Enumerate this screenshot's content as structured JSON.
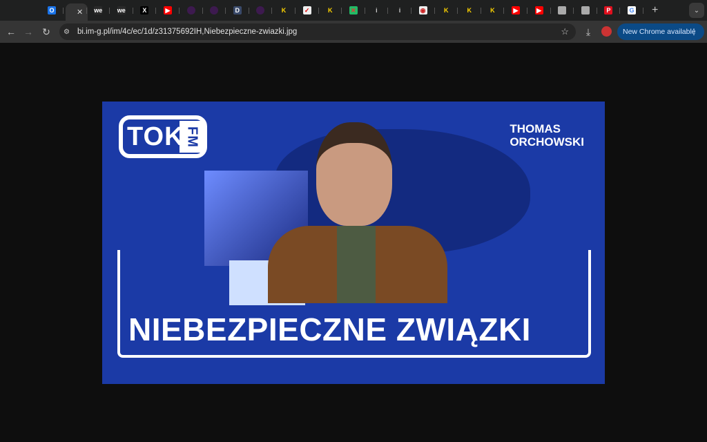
{
  "tabs": [
    {
      "icon": "outlook-icon",
      "color": "#1a73e8",
      "glyph": "O"
    },
    {
      "icon": "blank-icon",
      "color": "#353535",
      "glyph": "",
      "active": true
    },
    {
      "icon": "we-icon",
      "color": "#2a2a2a",
      "glyph": "we"
    },
    {
      "icon": "we-icon",
      "color": "#2a2a2a",
      "glyph": "we"
    },
    {
      "icon": "x-icon",
      "color": "#000",
      "glyph": "X"
    },
    {
      "icon": "youtube-icon",
      "color": "#ff0000",
      "glyph": "▶"
    },
    {
      "icon": "purple-circle-icon",
      "color": "#3d1a4f",
      "glyph": ""
    },
    {
      "icon": "purple-circle-icon",
      "color": "#3d1a4f",
      "glyph": ""
    },
    {
      "icon": "d-icon",
      "color": "#3a4a6a",
      "glyph": "D"
    },
    {
      "icon": "purple-circle-icon",
      "color": "#3d1a4f",
      "glyph": ""
    },
    {
      "icon": "k-icon",
      "color": "#1f2020",
      "glyph": "K",
      "fg": "#ffd400"
    },
    {
      "icon": "red-white-icon",
      "color": "#eee",
      "glyph": "✓",
      "fg": "#d00"
    },
    {
      "icon": "k-icon",
      "color": "#1f2020",
      "glyph": "K",
      "fg": "#ffd400"
    },
    {
      "icon": "multicolor-icon",
      "color": "#2b6",
      "glyph": "✕",
      "fg": "#e33"
    },
    {
      "icon": "figure-icon",
      "color": "#1f2020",
      "glyph": "i",
      "fg": "#ccc"
    },
    {
      "icon": "figure-icon",
      "color": "#1f2020",
      "glyph": "i",
      "fg": "#ccc"
    },
    {
      "icon": "badge-icon",
      "color": "#eee",
      "glyph": "◉",
      "fg": "#c22"
    },
    {
      "icon": "k-icon",
      "color": "#1f2020",
      "glyph": "K",
      "fg": "#ffd400"
    },
    {
      "icon": "k-icon",
      "color": "#1f2020",
      "glyph": "K",
      "fg": "#ffd400"
    },
    {
      "icon": "k-icon",
      "color": "#1f2020",
      "glyph": "K",
      "fg": "#ffd400"
    },
    {
      "icon": "youtube-icon",
      "color": "#ff0000",
      "glyph": "▶"
    },
    {
      "icon": "youtube-icon",
      "color": "#ff0000",
      "glyph": "▶"
    },
    {
      "icon": "gray-square-icon",
      "color": "#aaa",
      "glyph": ""
    },
    {
      "icon": "gray-square-icon",
      "color": "#aaa",
      "glyph": ""
    },
    {
      "icon": "p-icon",
      "color": "#e0101e",
      "glyph": "P"
    },
    {
      "icon": "google-icon",
      "color": "#fff",
      "glyph": "G",
      "fg": "#4285f4"
    }
  ],
  "toolbar": {
    "url": "bi.im-g.pl/im/4c/ec/1d/z31375692IH,Niebezpieczne-zwiazki.jpg",
    "new_chrome": "New Chrome available"
  },
  "image": {
    "logo_tok": "TOK",
    "logo_fm": "FM",
    "host_line1": "THOMAS",
    "host_line2": "ORCHOWSKI",
    "title": "NIEBEZPIECZNE ZWIĄZKI",
    "background_color": "#1b3aa6"
  }
}
